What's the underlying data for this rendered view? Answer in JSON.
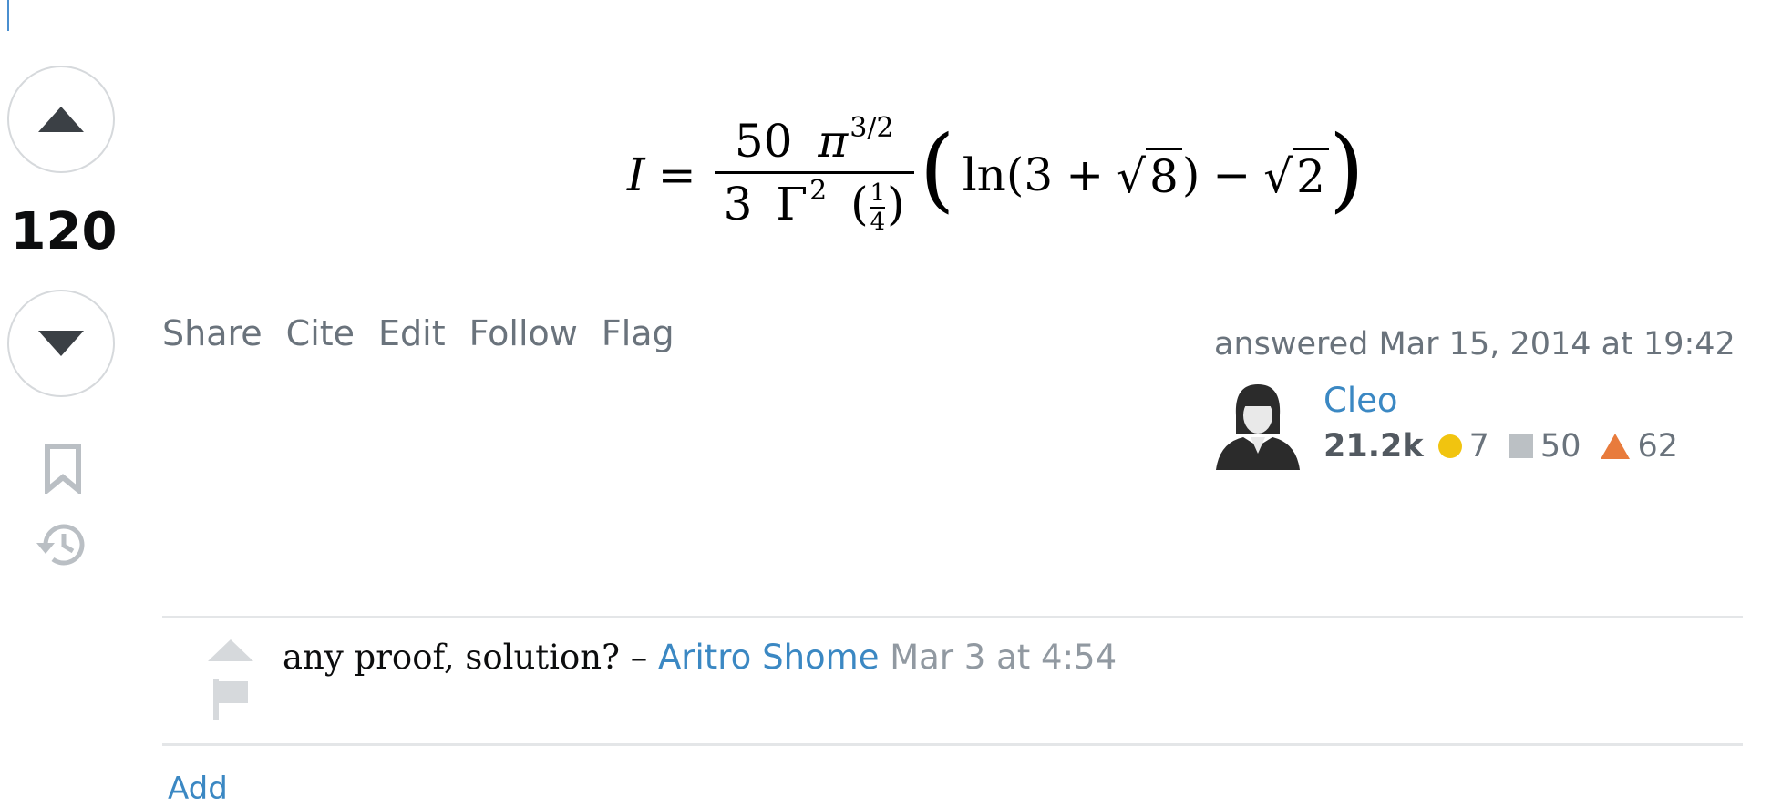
{
  "vote": {
    "count": "120"
  },
  "post_menu": [
    "Share",
    "Cite",
    "Edit",
    "Follow",
    "Flag"
  ],
  "answer_meta": {
    "answered_label": "answered Mar 15, 2014 at 19:42",
    "user_name": "Cleo",
    "reputation": "21.2k",
    "gold_badges": "7",
    "silver_badges": "50",
    "bronze_badges": "62"
  },
  "equation": {
    "lhs": "I",
    "equals": "=",
    "num_coef": "50",
    "pi": "π",
    "pi_exp": "3/2",
    "den_coef": "3",
    "gamma": "Γ",
    "gamma_exp": "2",
    "quarter_num": "1",
    "quarter_den": "4",
    "ln": "ln",
    "three": "3",
    "plus": "+",
    "eight": "8",
    "minus": "−",
    "two": "2",
    "open_paren": "(",
    "close_paren": ")"
  },
  "comment": {
    "text": "any proof, solution? – ",
    "author": "Aritro Shome",
    "time": "Mar 3 at 4:54"
  },
  "add_comment_partial": "Add",
  "colors": {
    "link": "#3b88c3",
    "muted": "#6a737c",
    "gold": "#f1c40f",
    "silver": "#bbc0c4",
    "bronze": "#e87b3c"
  }
}
